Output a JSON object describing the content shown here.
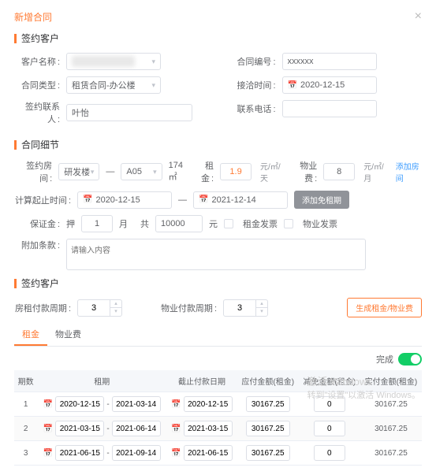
{
  "modal": {
    "title": "新增合同"
  },
  "s1": {
    "title": "签约客户",
    "name": "客户名称",
    "contractNo": "合同编号",
    "contractNoVal": "xxxxxx",
    "type": "合同类型",
    "typeVal": "租赁合同-办公楼",
    "receiveTime": "接洽时间",
    "receiveTimeVal": "2020-12-15",
    "contact": "签约联系人",
    "contactVal": "叶怡",
    "phone": "联系电话"
  },
  "s2": {
    "title": "合同细节",
    "room": "签约房间",
    "roomA": "研发楼",
    "roomB": "A05",
    "area": "174 ㎡",
    "rent": "租金",
    "rentVal": "1.9",
    "rentUnit": "元/㎡/天",
    "prop": "物业费",
    "propVal": "8",
    "propUnit": "元/㎡/月",
    "addRoom": "添加房间",
    "period": "计算起止时间",
    "start": "2020-12-15",
    "end": "2021-12-14",
    "addFree": "添加免租期",
    "deposit": "保证金",
    "ya": "押",
    "yaVal": "1",
    "month": "月",
    "gong": "共",
    "gongVal": "10000",
    "yuan": "元",
    "rentInv": "租金发票",
    "propInv": "物业发票",
    "extra": "附加条款",
    "extraPh": "请输入内容"
  },
  "s3": {
    "title": "签约客户",
    "rentCycle": "房租付款周期",
    "rentCycleVal": "3",
    "propCycle": "物业付款周期",
    "propCycleVal": "3",
    "genBtn": "生成租金/物业费",
    "tabRent": "租金",
    "tabProp": "物业费",
    "done": "完成"
  },
  "table": {
    "headers": [
      "期数",
      "租期",
      "截止付款日期",
      "应付金额(租金)",
      "减免金额(租金)",
      "实付金额(租金)"
    ],
    "rows": [
      {
        "n": "1",
        "from": "2020-12-15",
        "to": "2021-03-14",
        "due": "2020-12-15",
        "amount": "30167.25",
        "discount": "0",
        "actual": "30167.25"
      },
      {
        "n": "2",
        "from": "2021-03-15",
        "to": "2021-06-14",
        "due": "2021-03-15",
        "amount": "30167.25",
        "discount": "0",
        "actual": "30167.25"
      },
      {
        "n": "3",
        "from": "2021-06-15",
        "to": "2021-09-14",
        "due": "2021-06-15",
        "amount": "30167.25",
        "discount": "0",
        "actual": "30167.25"
      }
    ]
  },
  "wm": {
    "l1": "激活 Windows",
    "l2": "转到\"设置\"以激活 Windows。"
  }
}
